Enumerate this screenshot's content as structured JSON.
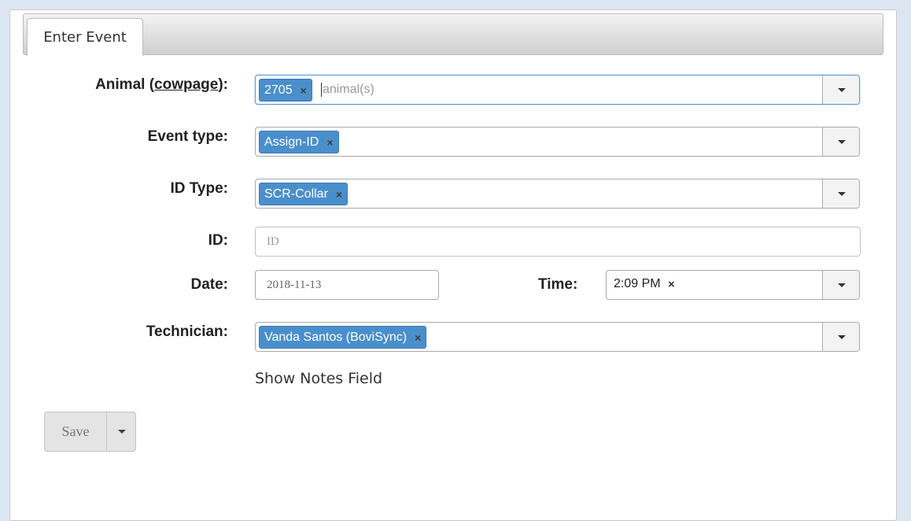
{
  "tab": {
    "label": "Enter Event"
  },
  "animal": {
    "label_prefix": "Animal (",
    "label_link": "cowpage",
    "label_suffix": "):",
    "chip": "2705",
    "placeholder": "animal(s)"
  },
  "event_type": {
    "label": "Event type:",
    "chip": "Assign-ID"
  },
  "id_type": {
    "label": "ID Type:",
    "chip": "SCR-Collar"
  },
  "id_field": {
    "label": "ID:",
    "placeholder": "ID"
  },
  "date": {
    "label": "Date:",
    "value": "2018-11-13"
  },
  "time": {
    "label": "Time:",
    "value": "2:09 PM"
  },
  "technician": {
    "label": "Technician:",
    "chip": "Vanda Santos (BoviSync)"
  },
  "notes": {
    "label": "Show Notes Field"
  },
  "save": {
    "label": "Save"
  },
  "remove_glyph": "×",
  "colors": {
    "chip": "#4a8fcc",
    "focus_border": "#5b9bd5"
  }
}
